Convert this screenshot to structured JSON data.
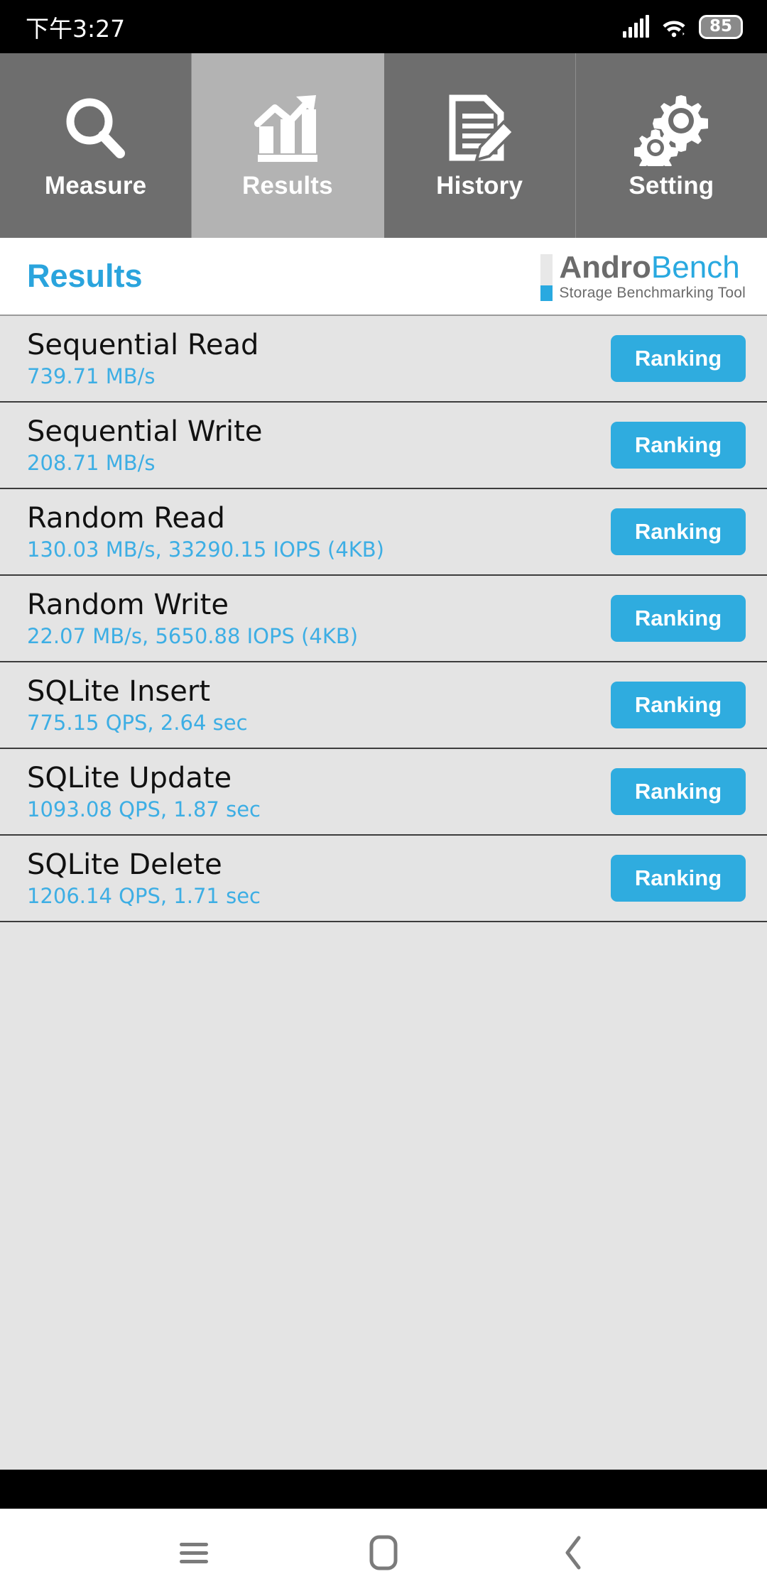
{
  "status_bar": {
    "time": "下午3:27",
    "battery_level": "85",
    "icons": [
      "signal-icon",
      "wifi-icon",
      "battery-icon"
    ]
  },
  "tabs": [
    {
      "label": "Measure",
      "icon": "magnifier-icon",
      "active": false
    },
    {
      "label": "Results",
      "icon": "bar-chart-arrow-icon",
      "active": true
    },
    {
      "label": "History",
      "icon": "document-pencil-icon",
      "active": false
    },
    {
      "label": "Setting",
      "icon": "gears-icon",
      "active": false
    }
  ],
  "header": {
    "page_title": "Results",
    "brand_primary": "Andro",
    "brand_secondary": "Bench",
    "brand_subtitle": "Storage Benchmarking Tool"
  },
  "results": [
    {
      "name": "Sequential Read",
      "value": "739.71 MB/s",
      "button": "Ranking"
    },
    {
      "name": "Sequential Write",
      "value": "208.71 MB/s",
      "button": "Ranking"
    },
    {
      "name": "Random Read",
      "value": "130.03 MB/s, 33290.15 IOPS (4KB)",
      "button": "Ranking"
    },
    {
      "name": "Random Write",
      "value": "22.07 MB/s, 5650.88 IOPS (4KB)",
      "button": "Ranking"
    },
    {
      "name": "SQLite Insert",
      "value": "775.15 QPS, 2.64 sec",
      "button": "Ranking"
    },
    {
      "name": "SQLite Update",
      "value": "1093.08 QPS, 1.87 sec",
      "button": "Ranking"
    },
    {
      "name": "SQLite Delete",
      "value": "1206.14 QPS, 1.71 sec",
      "button": "Ranking"
    }
  ],
  "navigation": {
    "recents": "menu-icon",
    "home": "home-square-icon",
    "back": "back-chevron-icon"
  },
  "colors": {
    "accent_blue": "#2facdf",
    "value_blue": "#3daee4",
    "brand_gray": "#6b6b6b",
    "tab_inactive": "#6e6e6e",
    "tab_active": "#b3b3b3",
    "list_bg": "#e4e4e4"
  }
}
